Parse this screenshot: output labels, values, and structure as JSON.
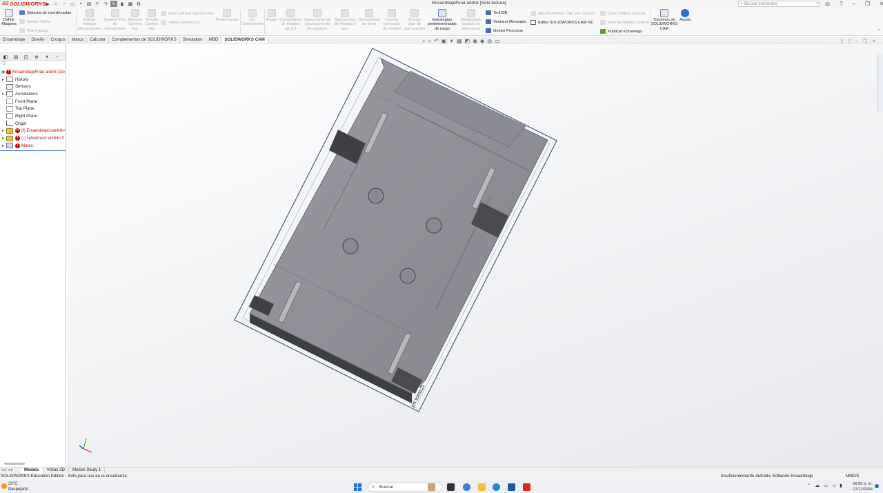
{
  "app": {
    "brand": "SOLIDWORKS",
    "window_title": "EnsamblajeFinal andrik [Sólo lectura]",
    "search_placeholder": "Buscar comandos"
  },
  "ribbon": {
    "define_machine": "Definir Máquina",
    "coord_system": "Sistema de coordenadas",
    "manage_stock": "Gestor Techo",
    "work_piece": "Pick trabajo",
    "extract": "Extraer Rasgos Mecanizables",
    "generate_plan": "Generar Plan de Operaciones",
    "generate_toolpath": "Generar Camino Hta.",
    "simulate": "Simular Camino Hta.",
    "step_through": "Paso a Paso Camino Hta.",
    "save_cl": "Salvar Fichero CL",
    "postprocess": "Postprocesar",
    "op_operations": "Op. Operaciones",
    "feature": "Rasgo",
    "mill_25": "Operaciones de fresado eje 2.5",
    "hole_ops": "Operaciones de procesamiento de agujeros",
    "mill_3": "Operaciones de fresado 3 ejes",
    "turn_ops": "Operaciones de torno",
    "insert_probe": "Insertar operación de sondeo",
    "save_plan": "Guardar plan de operaciones",
    "default_strategies": "Estrategias predeterminadas de rasgo",
    "tolerance_machining": "Mecanizado basado en tolerancias",
    "techdb": "TechDB",
    "message_window": "Ventana Mensajes",
    "process_manager": "Gestor Procesos",
    "user_tools": "Hta./Portahtas. Def. por Usuario",
    "nc_editor": "Editor SOLIDWORKS CAM NC",
    "create_library": "Crear Objeto Librería",
    "insert_library": "Insertar Objeto Librería",
    "publish_edrawings": "Publicar eDrawings",
    "cam_options": "Opciones de SOLIDWORKS CAM",
    "help": "Ayuda"
  },
  "tabs": [
    "Ensamblaje",
    "Diseño",
    "Croquis",
    "Marca",
    "Calcular",
    "Complementos de SOLIDWORKS",
    "Simulation",
    "MBD",
    "SOLIDWORKS CAM"
  ],
  "active_tab": "SOLIDWORKS CAM",
  "tree": {
    "root": "EnsamblajeFinal andrik (De",
    "items": [
      {
        "label": "History"
      },
      {
        "label": "Sensors"
      },
      {
        "label": "Annotations"
      },
      {
        "label": "Front Plane"
      },
      {
        "label": "Top Plane"
      },
      {
        "label": "Right Plane"
      },
      {
        "label": "Origin"
      },
      {
        "label": "(f) Ensamblaje1andrik<"
      },
      {
        "label": "(-) cybertruck andrik<2"
      },
      {
        "label": "Mates"
      }
    ]
  },
  "bottom_tabs": [
    "Modelo",
    "Vistas 3D",
    "Motion Study 1"
  ],
  "status": {
    "left": "SOLIDWORKS Education Edition - Sólo para uso en la enseñanza",
    "defined": "Insuficientemente definida",
    "editing": "Editando Ensamblaje",
    "units": "MMGS"
  },
  "taskbar": {
    "temp": "20°C",
    "weather": "Despejado",
    "search": "Buscar",
    "time": "06:50 p. m.",
    "date": "27/11/2024"
  },
  "model": {
    "engraving": "jm tomo2l"
  },
  "colors": {
    "brand_red": "#d52b1e",
    "part_gray": "#8f9097",
    "accent_blue": "#3b7dd8"
  }
}
